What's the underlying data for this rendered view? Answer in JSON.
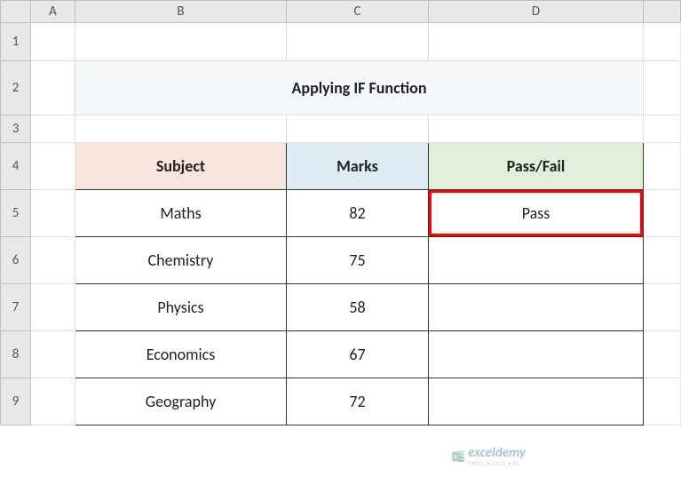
{
  "columns": [
    "A",
    "B",
    "C",
    "D"
  ],
  "rows": [
    "1",
    "2",
    "3",
    "4",
    "5",
    "6",
    "7",
    "8",
    "9"
  ],
  "title": "Applying IF Function",
  "headers": {
    "subject": "Subject",
    "marks": "Marks",
    "passfail": "Pass/Fail"
  },
  "data": [
    {
      "subject": "Maths",
      "marks": "82",
      "result": "Pass"
    },
    {
      "subject": "Chemistry",
      "marks": "75",
      "result": ""
    },
    {
      "subject": "Physics",
      "marks": "58",
      "result": ""
    },
    {
      "subject": "Economics",
      "marks": "67",
      "result": ""
    },
    {
      "subject": "Geography",
      "marks": "72",
      "result": ""
    }
  ],
  "watermark": {
    "main": "exceldemy",
    "sub": "EXCEL • DATA • BI"
  }
}
